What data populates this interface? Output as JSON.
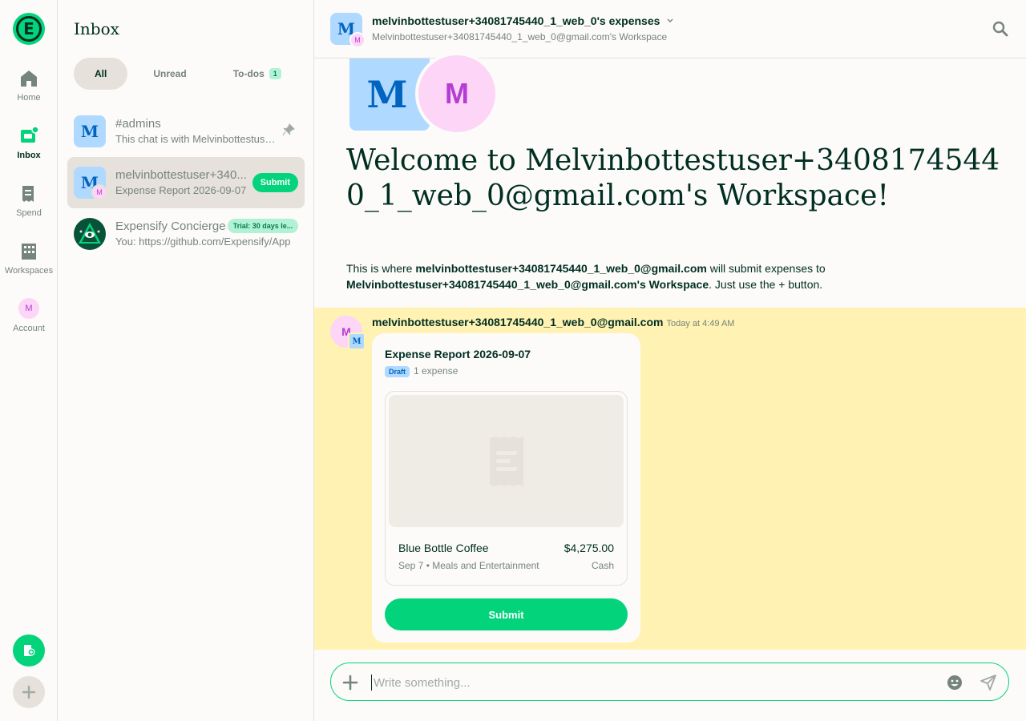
{
  "nav": {
    "logo_letter": "E",
    "items": [
      {
        "label": "Home",
        "icon": "home-icon"
      },
      {
        "label": "Inbox",
        "icon": "inbox-icon"
      },
      {
        "label": "Spend",
        "icon": "receipt-icon"
      },
      {
        "label": "Workspaces",
        "icon": "building-icon"
      },
      {
        "label": "Account",
        "icon": "avatar",
        "avatar_letter": "M"
      }
    ]
  },
  "lhn": {
    "title": "Inbox",
    "filters": [
      {
        "label": "All"
      },
      {
        "label": "Unread"
      },
      {
        "label": "To-dos",
        "count": "1"
      }
    ],
    "rows": [
      {
        "avatar": "M",
        "title": "#admins",
        "subtitle": "This chat is with Melvinbottestuser..."
      },
      {
        "avatar": "M",
        "sub_avatar": "M",
        "title": "melvinbottestuser+340...",
        "subtitle": "Expense Report 2026-09-07",
        "action": "Submit"
      },
      {
        "title": "Expensify Concierge",
        "subtitle": "You: https://github.com/Expensify/App",
        "badge": "Trial: 30 days le..."
      }
    ]
  },
  "header": {
    "avatar": "M",
    "sub_avatar": "M",
    "title": "melvinbottestuser+34081745440_1_web_0's expenses",
    "subtitle": "Melvinbottestuser+34081745440_1_web_0@gmail.com's Workspace"
  },
  "welcome": {
    "avatar_box": "M",
    "avatar_circle": "M",
    "title": "Welcome to Melvinbottestuser+34081745440_1_web_0@gmail.com's Workspace!",
    "desc_1": "This is where ",
    "desc_user": "melvinbottestuser+34081745440_1_web_0@gmail.com",
    "desc_2": " will submit expenses to ",
    "desc_ws": "Melvinbottestuser+34081745440_1_web_0@gmail.com's Workspace",
    "desc_3": ". Just use the + button."
  },
  "message": {
    "avatar": "M",
    "sub_avatar": "M",
    "author": "melvinbottestuser+34081745440_1_web_0@gmail.com",
    "time": "Today at 4:49 AM",
    "card": {
      "title": "Expense Report 2026-09-07",
      "status": "Draft",
      "count": "1 expense",
      "expense": {
        "merchant": "Blue Bottle Coffee",
        "amount": "$4,275.00",
        "meta": "Sep 7 • Meals and Entertainment",
        "type": "Cash"
      },
      "submit_label": "Submit"
    }
  },
  "composer": {
    "placeholder": "Write something..."
  },
  "colors": {
    "brand_green": "#03d47c",
    "highlight": "#fff2b3",
    "dark_text": "#002e22"
  }
}
